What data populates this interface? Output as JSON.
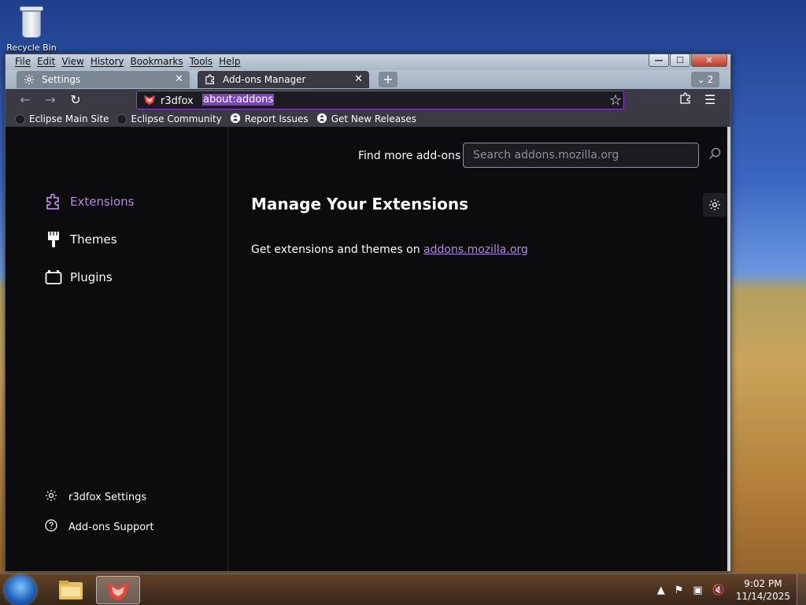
{
  "desktop": {
    "recycle_bin_label": "Recycle Bin"
  },
  "menubar": [
    "File",
    "Edit",
    "View",
    "History",
    "Bookmarks",
    "Tools",
    "Help"
  ],
  "window_controls": {
    "minimize": "—",
    "maximize": "☐",
    "close": "✕"
  },
  "tabs": [
    {
      "label": "Settings",
      "icon": "gear-icon",
      "active": false
    },
    {
      "label": "Add-ons Manager",
      "icon": "puzzle-icon",
      "active": true
    }
  ],
  "tab_count": "2",
  "urlbar": {
    "identity": "r3dfox",
    "url": "about:addons"
  },
  "bookmarks": [
    {
      "label": "Eclipse Main Site",
      "icon": "eclipse-icon"
    },
    {
      "label": "Eclipse Community",
      "icon": "eclipse-icon"
    },
    {
      "label": "Report Issues",
      "icon": "github-icon"
    },
    {
      "label": "Get New Releases",
      "icon": "github-icon"
    }
  ],
  "sidebar": {
    "categories": [
      {
        "label": "Extensions",
        "icon": "puzzle-icon",
        "selected": true
      },
      {
        "label": "Themes",
        "icon": "brush-icon",
        "selected": false
      },
      {
        "label": "Plugins",
        "icon": "plugin-icon",
        "selected": false
      }
    ],
    "footer": [
      {
        "label": "r3dfox Settings",
        "icon": "gear-icon"
      },
      {
        "label": "Add-ons Support",
        "icon": "help-icon"
      }
    ]
  },
  "main": {
    "find_more_label": "Find more add-ons",
    "search_placeholder": "Search addons.mozilla.org",
    "heading": "Manage Your Extensions",
    "get_text_prefix": "Get extensions and themes on",
    "get_text_link": "addons.mozilla.org"
  },
  "taskbar": {
    "time": "9:02 PM",
    "date": "11/14/2025"
  },
  "colors": {
    "accent": "#b48ade",
    "url_border": "#8a3fd1",
    "content_bg": "#0c0c0e",
    "toolbar_bg": "#3a3944"
  }
}
